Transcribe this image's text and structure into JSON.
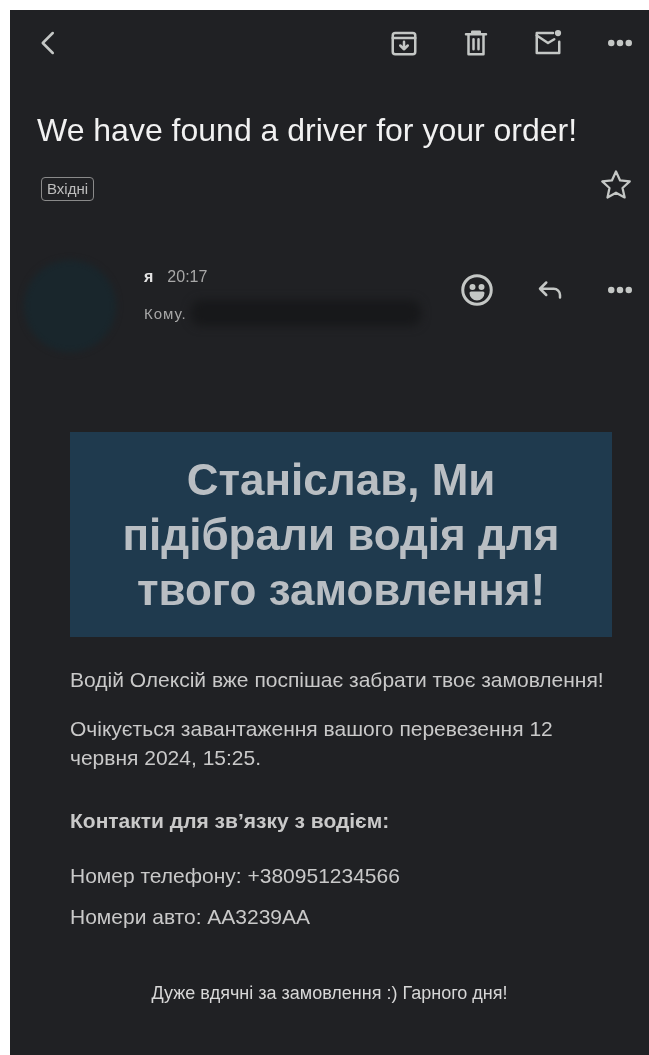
{
  "subject": {
    "title": "We have found a driver for your order!",
    "label": "Вхідні",
    "starred": false
  },
  "message": {
    "sender": "я",
    "time": "20:17",
    "recipient_label": "Кому."
  },
  "body": {
    "banner": "Станіслав, Ми підібрали водія для твого замовлення!",
    "paragraphs": [
      {
        "kind": "text",
        "text": "Водій Олексій вже поспішає забрати твоє замовлення!"
      },
      {
        "kind": "text",
        "text": "Очікується завантаження вашого перевезення 12 червня 2024, 15:25."
      },
      {
        "kind": "heading",
        "text": "Контакти для зв’язку з водієм:"
      }
    ],
    "contacts": [
      "Номер телефону: +380951234566",
      "Номери авто: AA3239AA"
    ],
    "footer": "Дуже вдячні за замовлення :) Гарного дня!"
  }
}
